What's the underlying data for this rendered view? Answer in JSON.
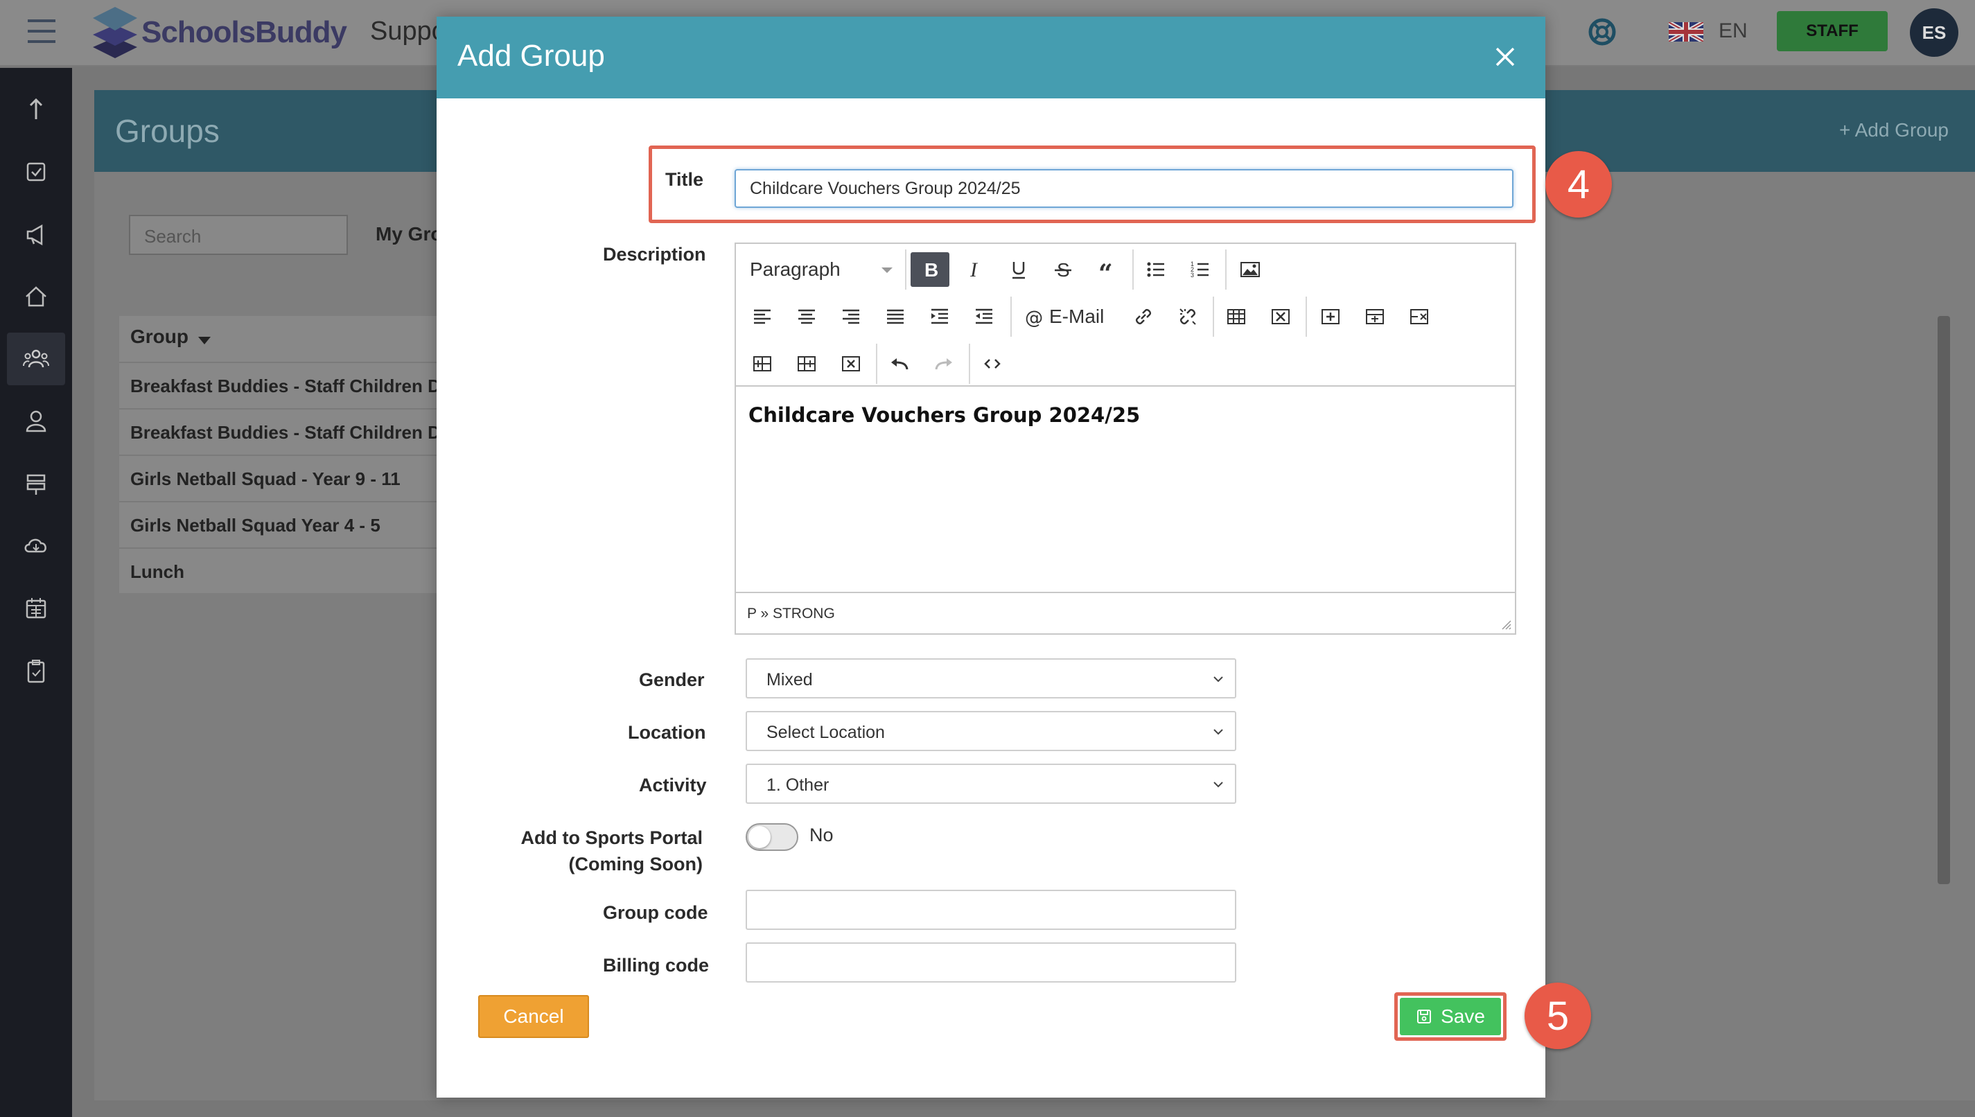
{
  "app": {
    "brand": "SchoolsBuddy",
    "section": "Support",
    "language": "EN",
    "staff_label": "STAFF",
    "avatar_initials": "ES"
  },
  "groups_page": {
    "title": "Groups",
    "add_group_label": "+ Add Group",
    "search_placeholder": "Search",
    "tab_label": "My Gro",
    "column_header": "Group",
    "rows": [
      "Breakfast Buddies - Staff Children Disc",
      "Breakfast Buddies - Staff Children Disc",
      "Girls Netball Squad - Year 9 - 11",
      "Girls Netball Squad Year 4 - 5",
      "Lunch"
    ]
  },
  "modal": {
    "title": "Add Group",
    "labels": {
      "title": "Title",
      "description": "Description",
      "gender": "Gender",
      "location": "Location",
      "activity": "Activity",
      "sports_portal_line1": "Add to Sports Portal",
      "sports_portal_line2": "(Coming Soon)",
      "group_code": "Group code",
      "billing_code": "Billing code"
    },
    "title_value": "Childcare Vouchers Group 2024/25",
    "editor": {
      "paragraph_format": "Paragraph",
      "email_label": "E-Mail",
      "content": "Childcare Vouchers Group 2024/25",
      "path": "P » STRONG"
    },
    "gender_value": "Mixed",
    "location_value": "Select Location",
    "activity_value": "1. Other",
    "sports_portal_toggle": "No",
    "group_code_value": "",
    "billing_code_value": "",
    "cancel_label": "Cancel",
    "save_label": "Save"
  },
  "annotations": {
    "step_title": "4",
    "step_save": "5"
  },
  "colors": {
    "modal_header": "#459db0",
    "highlight": "#e16553",
    "badge": "#e85a48",
    "save": "#43c25e",
    "cancel": "#efa133",
    "staff": "#2f7a3a"
  }
}
